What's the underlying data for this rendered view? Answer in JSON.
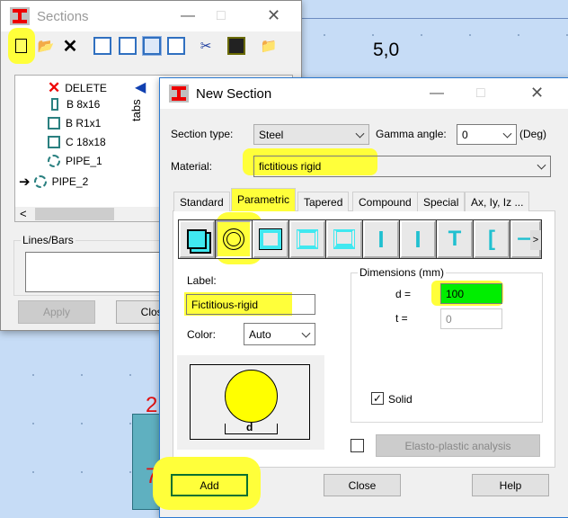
{
  "canvas": {
    "coord_label": "5,0",
    "node_labels": [
      "2",
      "7"
    ]
  },
  "sections_window": {
    "title": "Sections",
    "toolbar": [
      "new-icon",
      "open-icon",
      "delete-icon",
      "view1-icon",
      "view2-icon",
      "view3-icon",
      "view4-icon",
      "cut-icon",
      "save-icon",
      "folder-star-icon"
    ],
    "list": [
      {
        "label": "DELETE",
        "icon": "delete"
      },
      {
        "label": "B 8x16",
        "icon": "rect-narrow"
      },
      {
        "label": "B R1x1",
        "icon": "rect"
      },
      {
        "label": "C 18x18",
        "icon": "rect"
      },
      {
        "label": "PIPE_1",
        "icon": "circle"
      },
      {
        "label": "PIPE_2",
        "icon": "circle",
        "current": true
      }
    ],
    "tabs_label": "tabs",
    "lines_bars_label": "Lines/Bars",
    "apply": "Apply",
    "close": "Close"
  },
  "new_section": {
    "title": "New Section",
    "section_type_label": "Section type:",
    "section_type": "Steel",
    "gamma_label": "Gamma angle:",
    "gamma": "0",
    "gamma_unit": "(Deg)",
    "material_label": "Material:",
    "material": "fictitious rigid",
    "tabs": [
      "Standard",
      "Parametric",
      "Tapered",
      "Compound",
      "Special",
      "Ax, Iy, Iz ..."
    ],
    "active_tab": "Parametric",
    "label_label": "Label:",
    "label_value": "Fictitious-rigid",
    "color_label": "Color:",
    "color_value": "Auto",
    "preview_dim": "d",
    "dimensions_title": "Dimensions (mm)",
    "d_label": "d  =",
    "d_value": "100",
    "t_label": "t  =",
    "t_value": "0",
    "solid_label": "Solid",
    "solid_checked": true,
    "elasto_label": "Elasto-plastic analysis",
    "elasto_checked": false,
    "add": "Add",
    "close": "Close",
    "help": "Help",
    "more": ">"
  }
}
